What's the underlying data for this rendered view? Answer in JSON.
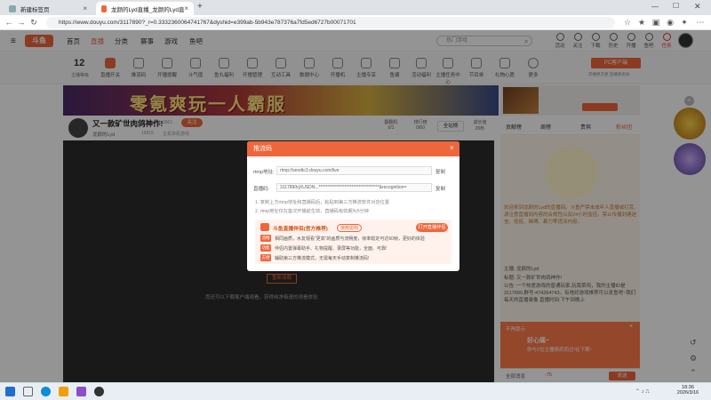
{
  "browser": {
    "tabs": [
      {
        "label": "新建标签页"
      },
      {
        "label": "龙颜的Lyd直播_龙颜的Lyd直播_斗鱼..."
      }
    ],
    "new_tab": "+",
    "url": "https://www.douyu.com/3117890?_r=0.3332360064741767&dyshid=e399ab-5b943e787376a7fd5ed6727b00071701"
  },
  "douyu": {
    "logo": "斗鱼",
    "nav": [
      "首页",
      "直播",
      "分类",
      "赛事",
      "游戏",
      "鱼吧"
    ],
    "search_placeholder": "热门游戏",
    "header_icons": [
      {
        "icon": "activity-icon",
        "label": "活动"
      },
      {
        "icon": "follow-icon",
        "label": "关注"
      },
      {
        "icon": "download-icon",
        "label": "下载"
      },
      {
        "icon": "history-icon",
        "label": "历史"
      },
      {
        "icon": "broadcast-icon",
        "label": "开播"
      },
      {
        "icon": "fishbar-icon",
        "label": "鱼吧"
      },
      {
        "icon": "gift-icon",
        "label": "任务"
      }
    ],
    "user_level": "12",
    "user_level_label": "主播等级",
    "categories": [
      "直播开关",
      "推流码",
      "开播提醒",
      "斗气值",
      "鱼丸福利",
      "开播管理",
      "互动工具",
      "数据中心",
      "开播机",
      "主播专享",
      "鱼塘",
      "活动福利",
      "主播任务中心",
      "节目单",
      "礼物心愿",
      "更多"
    ],
    "pc_client_label": "PC客户端",
    "pc_client_sub": "开播更方便 直播更高效",
    "banner_text": "零氪爽玩一人霸服",
    "room": {
      "title": "又一款矿世肉鸽神作!",
      "views": "9961",
      "follow_label": "关注",
      "streamer": "龙颜的Lyd",
      "fans": "16815",
      "category": "主机单机游戏",
      "followers_label": "翻翻机",
      "followers_value": "0/1",
      "rank_label": "排行榜",
      "rank_value": "0/60",
      "fullscreen_label": "全站榜",
      "box_label": "成长值",
      "box_value": "20秒"
    },
    "rank_tabs": [
      "贡献榜",
      "周榜",
      "贵宾",
      "粉丝团"
    ],
    "chat_messages": [
      "欢迎来到龙颜的Lyd的直播间。斗鱼严禁未成年人直播或打赏,请注意直播间内容的合规性以及24小时监控。禁止传播封建迷信、低俗、赌博、暴力等违法内容。",
      "主播: 龙颜的Lyd",
      "标题: 又一款矿世肉鸽神作!",
      "公告: 一个热爱游戏的普通玩家,玩我菜鸡，我的主播ID是3117890,群号:474264743。有啥好游戏推荐可以发鱼吧~我们每天的直播录像 直播时间:下午到晚上"
    ],
    "ad": {
      "tag": "不再提示",
      "line1": "好心痛~",
      "line2": "你与1位主播擦肩而过!在下期~"
    },
    "chat_send": "发送",
    "chat_receive_label": "全部消息",
    "progress_label": "-75"
  },
  "modal": {
    "title": "推流码",
    "rtmp_label": "rtmp地址:",
    "rtmp_value": "rtmp://sendtc3.douyu.com/live",
    "code_label": "直播码:",
    "code_value": "3117890rjXUSDN...***********************************&recognition=",
    "copy_label": "复制",
    "tip1": "1. 复制上方rtmp地址和直播码后，粘贴到第三方推流软件对应位置",
    "tip2": "2. rtmp地址仅在首次开播前生效，直播码有效期为5分钟",
    "promo_title": "斗鱼直播伴侣(官方推荐)",
    "promo_badge": "使用说明",
    "open_btn": "打开直播伴侣",
    "promo_items": [
      {
        "tag": "流畅",
        "text": "相同画质，水友观看“更高”的画质与流畅度，帧率稳定可达60帧，更好的体验"
      },
      {
        "tag": "功能",
        "text": "伴侣内置弹幕助手、礼物提醒、录屏等功能，全面、可靠!"
      },
      {
        "tag": "方便",
        "text": "辅助第三方推流模式，无需每天手动复制推流码!"
      }
    ]
  },
  "video": {
    "restart_btn": "重新加载",
    "hint": "您还可以下载客户端观看，获得纯净极速的观看体验",
    "hint_highlight": "下载客户端"
  },
  "taskbar": {
    "time": "18:36",
    "date": "2026/3/16"
  }
}
